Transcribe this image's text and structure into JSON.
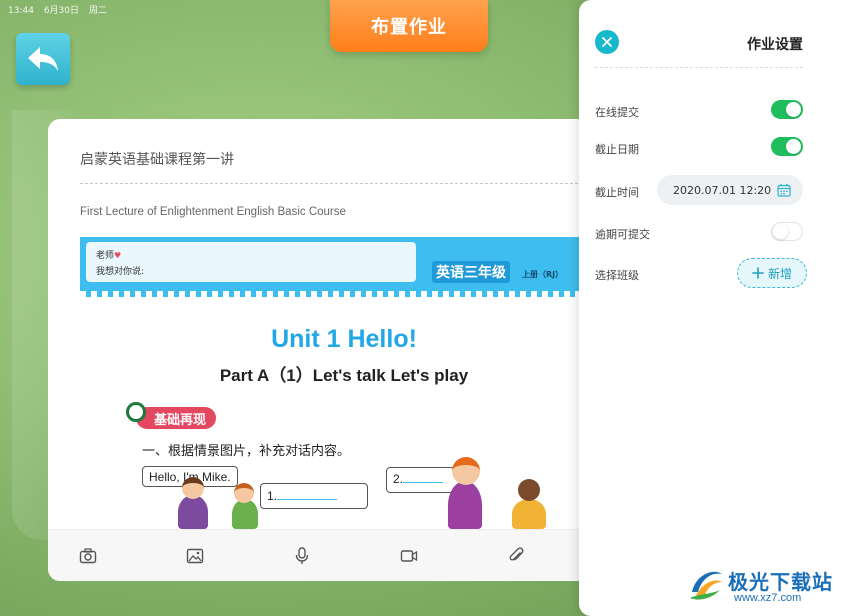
{
  "status_bar": {
    "time": "13:44",
    "date": "6月30日",
    "weekday": "周二"
  },
  "header": {
    "assign_button": "布置作业",
    "back_icon": "back-arrow-icon"
  },
  "lesson": {
    "title": "启蒙英语基础课程第一讲",
    "description": "First Lecture of Enlightenment English Basic Course"
  },
  "worksheet": {
    "note_line1": "老师",
    "note_heart": "♥",
    "note_line2": "我想对你说:",
    "grade": "英语三年级",
    "edition": "上册（RJ）",
    "unit": "Unit 1   Hello!",
    "part": "Part A（1）Let's talk    Let's play",
    "section": "基础再现",
    "instruction": "一、根据情景图片，补充对话内容。",
    "bubble1": "Hello, I'm Mike.",
    "bubble2_num": "1.",
    "bubble3_num": "2."
  },
  "toolbar": {
    "items": [
      "camera-icon",
      "image-icon",
      "microphone-icon",
      "video-icon",
      "attachment-icon"
    ]
  },
  "settings": {
    "title": "作业设置",
    "online_submit_label": "在线提交",
    "online_submit_on": true,
    "deadline_date_label": "截止日期",
    "deadline_date_on": true,
    "deadline_time_label": "截止时间",
    "deadline_time_value": "2020.07.01 12:20",
    "late_submit_label": "逾期可提交",
    "late_submit_on": false,
    "select_class_label": "选择班级",
    "add_button_label": "新增"
  },
  "watermark": {
    "main": "极光下载站",
    "sub": "www.xz7.com"
  },
  "colors": {
    "accent_teal": "#18b9cc",
    "toggle_green": "#1fbd5c",
    "assign_orange": "#ff8a2a"
  }
}
